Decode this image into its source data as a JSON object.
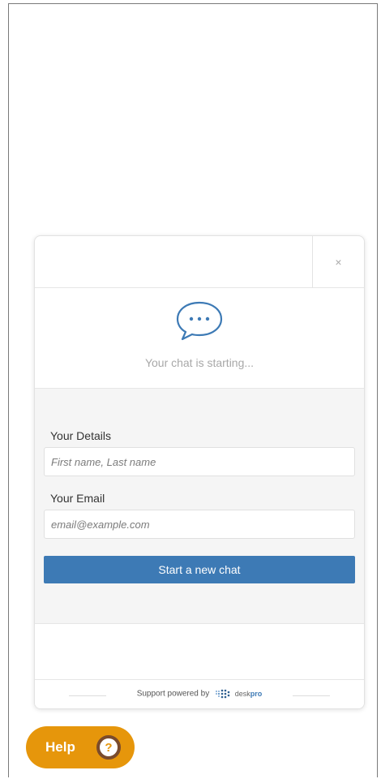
{
  "widget": {
    "close_symbol": "×",
    "status_text": "Your chat is starting...",
    "chat_icon": "speech-bubble-ellipsis-icon",
    "form": {
      "details_label": "Your Details",
      "details_placeholder": "First name, Last name",
      "email_label": "Your Email",
      "email_placeholder": "email@example.com",
      "submit_label": "Start a new chat"
    },
    "footer": {
      "powered_text": "Support powered by",
      "brand_part1": "desk",
      "brand_part2": "pro"
    }
  },
  "help_button": {
    "label": "Help",
    "icon_glyph": "?"
  },
  "colors": {
    "accent": "#3d7ab5",
    "help_orange": "#e6960b",
    "help_icon_ring": "#7a4b2c",
    "form_background": "#f5f5f5"
  }
}
